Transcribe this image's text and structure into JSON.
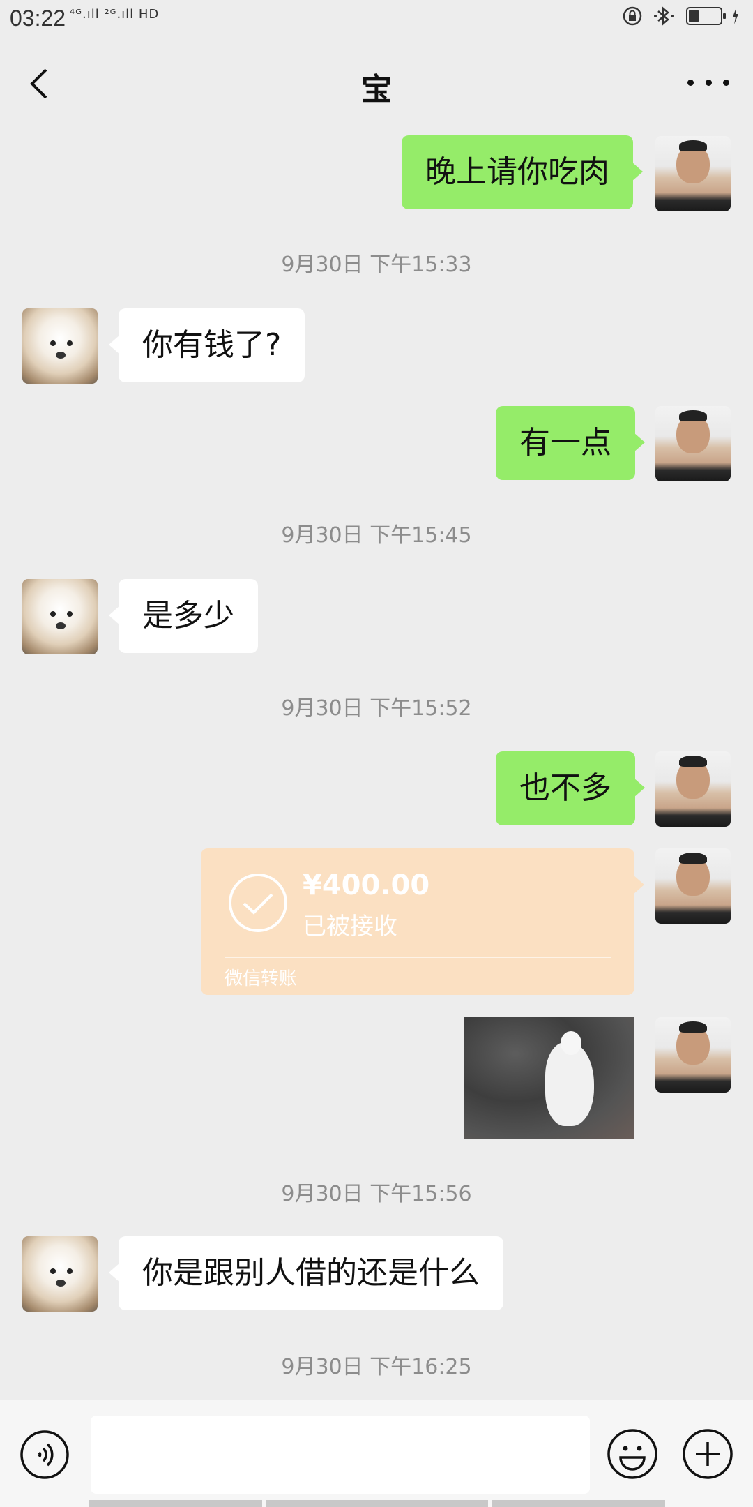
{
  "status_bar": {
    "time": "03:22",
    "signal_text": "⁴ᴳ.ıll ²ᴳ.ıll HD",
    "battery_level": 0.3
  },
  "header": {
    "title": "宝",
    "back_icon": "chevron-left-icon",
    "more_icon": "more-icon"
  },
  "messages": [
    {
      "type": "text",
      "from": "me",
      "text": "晚上请你吃肉"
    },
    {
      "type": "time",
      "text": "9月30日 下午15:33"
    },
    {
      "type": "text",
      "from": "other",
      "text": "你有钱了?"
    },
    {
      "type": "text",
      "from": "me",
      "text": "有一点"
    },
    {
      "type": "time",
      "text": "9月30日 下午15:45"
    },
    {
      "type": "text",
      "from": "other",
      "text": "是多少"
    },
    {
      "type": "time",
      "text": "9月30日 下午15:52"
    },
    {
      "type": "text",
      "from": "me",
      "text": "也不多"
    },
    {
      "type": "transfer",
      "from": "me",
      "amount": "¥400.00",
      "status": "已被接收",
      "label": "微信转账"
    },
    {
      "type": "image",
      "from": "me"
    },
    {
      "type": "time",
      "text": "9月30日 下午15:56"
    },
    {
      "type": "text",
      "from": "other",
      "text": "你是跟别人借的还是什么"
    },
    {
      "type": "time",
      "text": "9月30日 下午16:25"
    }
  ],
  "input_bar": {
    "voice_icon": "voice-icon",
    "emoji_icon": "emoji-icon",
    "plus_icon": "plus-icon",
    "value": ""
  },
  "colors": {
    "outgoing_bubble": "#95ec69",
    "incoming_bubble": "#ffffff",
    "transfer_card": "#fbe0c2",
    "background": "#ededed"
  }
}
